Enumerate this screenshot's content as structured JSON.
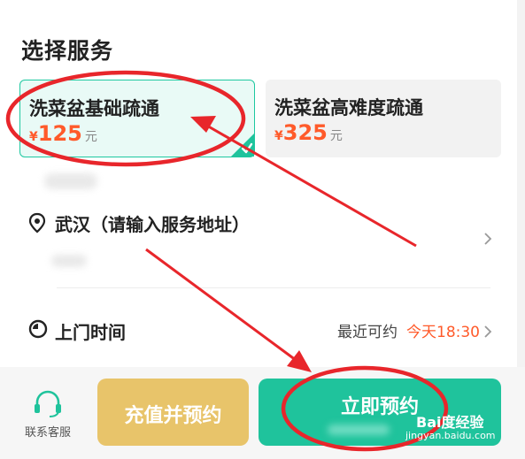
{
  "section": {
    "title": "选择服务"
  },
  "services": [
    {
      "name": "洗菜盆基础疏通",
      "currency": "¥",
      "amount": "125",
      "unit": "元",
      "selected": true
    },
    {
      "name": "洗菜盆高难度疏通",
      "currency": "¥",
      "amount": "325",
      "unit": "元",
      "selected": false
    }
  ],
  "address": {
    "icon": "location-pin-icon",
    "text": "武汉（请输入服务地址）"
  },
  "time": {
    "icon": "clock-icon",
    "label": "上门时间",
    "available_label": "最近可约",
    "available_value": "今天18:30"
  },
  "bottom": {
    "contact_label": "联系客服",
    "recharge_button": "充值并预约",
    "book_button": "立即预约"
  },
  "watermark": {
    "logo": "Bai度经验",
    "site": "jingyan.baidu.com"
  },
  "colors": {
    "accent": "#1fc39c",
    "price": "#ff5a2a",
    "recharge": "#e8c46a",
    "annotation": "#e8262b"
  }
}
